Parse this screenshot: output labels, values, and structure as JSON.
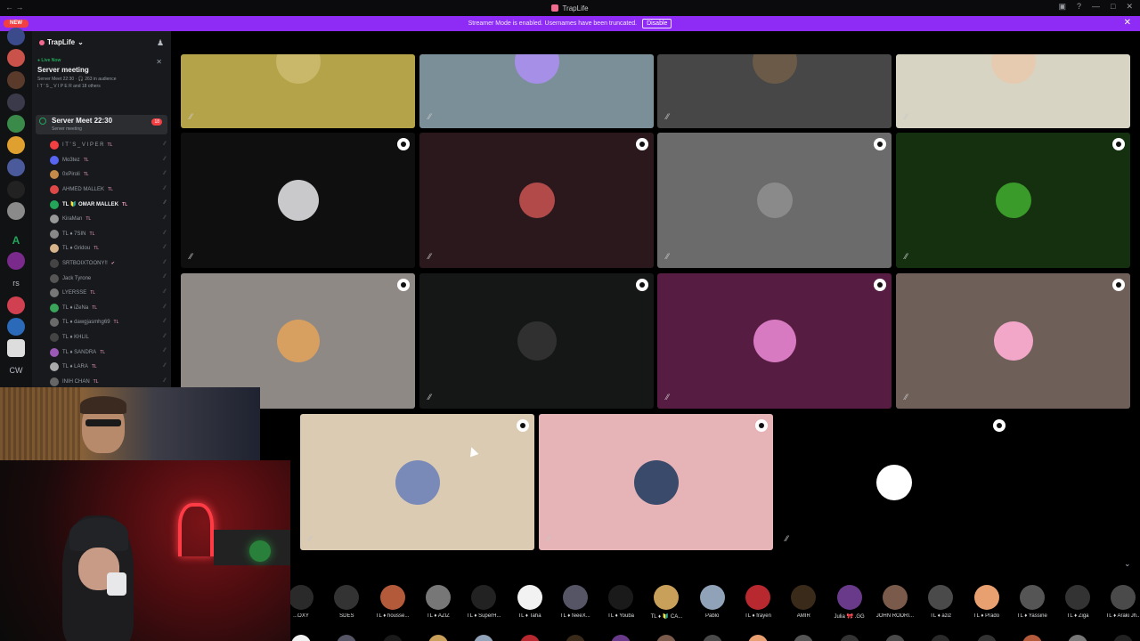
{
  "window": {
    "title": "TrapLife"
  },
  "banner": {
    "text": "Streamer Mode is enabled. Usernames have been truncated.",
    "disable_label": "Disable"
  },
  "rail": {
    "new_badge": "NEW",
    "letter_a": "A",
    "text_rs": "rs",
    "text_cw": "CW"
  },
  "server": {
    "name": "TrapLife"
  },
  "live": {
    "label": "● Live Now",
    "title": "Server meeting",
    "line1": "Server Meet 22:30 · 🎧 263 in audience",
    "line2": "I T ' S _ V I P E R and 18 others"
  },
  "stage_channel": {
    "name": "Server Meet 22:30",
    "sub": "Server meeting",
    "count": "18"
  },
  "members": [
    {
      "name": "I T ' S _ V I P E R",
      "tag": "TL",
      "color": "#f23f42"
    },
    {
      "name": "Mo3tez",
      "tag": "TL",
      "color": "#5865f2"
    },
    {
      "name": "0xPiroli",
      "tag": "TL",
      "color": "#c38a4a"
    },
    {
      "name": "AHMED MALLEK",
      "tag": "TL",
      "color": "#e04848"
    },
    {
      "name": "TL 🔰 OMAR MALLEK",
      "tag": "TL",
      "color": "#23a55a"
    },
    {
      "name": "KiraMan",
      "tag": "TL",
      "color": "#999"
    },
    {
      "name": "TL ♦ 7SIN",
      "tag": "TL",
      "color": "#888"
    },
    {
      "name": "TL ♦ Gridou",
      "tag": "TL",
      "color": "#d8b48c"
    },
    {
      "name": "SRTBOIXTOONY!!",
      "tag": "✔",
      "color": "#444"
    },
    {
      "name": "Jack Tyrone",
      "tag": "",
      "color": "#555"
    },
    {
      "name": "LYERSSE",
      "tag": "TL",
      "color": "#777"
    },
    {
      "name": "TL ♦ iZeNa",
      "tag": "TL",
      "color": "#3aa55a"
    },
    {
      "name": "TL ♦ dawgjasmhg69",
      "tag": "TL",
      "color": "#6a6a6a"
    },
    {
      "name": "TL ♦ KHLIL",
      "tag": "",
      "color": "#444"
    },
    {
      "name": "TL ♦ SANDRA",
      "tag": "TL",
      "color": "#9b59b6"
    },
    {
      "name": "TL ♦ LARA",
      "tag": "TL",
      "color": "#aaa"
    },
    {
      "name": "INIH CHAN",
      "tag": "TL",
      "color": "#666"
    }
  ],
  "audience": [
    {
      "name": "...OXY",
      "color": "#2a2a2a"
    },
    {
      "name": "SDES",
      "color": "#333"
    },
    {
      "name": "TL ♦ housse...",
      "color": "#b35a3a"
    },
    {
      "name": "TL ♦ AZIZ",
      "color": "#777"
    },
    {
      "name": "TL ♦ SuperH...",
      "color": "#222"
    },
    {
      "name": "TL ♦ Taha",
      "color": "#f2f2f2"
    },
    {
      "name": "TL ♦ feeeX...",
      "color": "#556"
    },
    {
      "name": "TL ♦ Youba",
      "color": "#1a1a1a"
    },
    {
      "name": "TL ♦ 🔰 CA...",
      "color": "#c9a05a"
    },
    {
      "name": "Pablo",
      "color": "#8fa2b8"
    },
    {
      "name": "TL ♦ frayen",
      "color": "#b8282f"
    },
    {
      "name": "AMIR",
      "color": "#3a2a1a"
    },
    {
      "name": "Julia 🎀 .GG",
      "color": "#6a3a8a"
    },
    {
      "name": "JOHN RODRI...",
      "color": "#7a5a4a"
    },
    {
      "name": "TL ♦ aziz",
      "color": "#4a4a4a"
    },
    {
      "name": "TL ♦ Prado",
      "color": "#e8a070"
    },
    {
      "name": "TL ♦ Yassine",
      "color": "#555"
    },
    {
      "name": "TL ♦ Ziga",
      "color": "#333"
    },
    {
      "name": "TL ♦ Araki Jh...",
      "color": "#4a4a4a"
    }
  ],
  "tiles": [
    {
      "bg": "#b5a34a",
      "avatar": "#c9b76a"
    },
    {
      "bg": "#7b8f99",
      "avatar": "#a68fe6"
    },
    {
      "bg": "#474747",
      "avatar": "#6b5a48"
    },
    {
      "bg": "#d8d4c3",
      "avatar": "#e6cbb0"
    },
    {
      "bg": "#0f0f0f",
      "avatar": "#c9c9cc"
    },
    {
      "bg": "#2a181d",
      "avatar": "#b24a4a"
    },
    {
      "bg": "#6b6b6b",
      "avatar": "#8a8a8a"
    },
    {
      "bg": "#14300f",
      "avatar": "#3a9a2a"
    },
    {
      "bg": "#8f8985",
      "avatar": "#d8a060"
    },
    {
      "bg": "#151717",
      "avatar": "#303030"
    },
    {
      "bg": "#561c42",
      "avatar": "#d87ac2"
    },
    {
      "bg": "#6e5f58",
      "avatar": "#f2a6c8"
    },
    {
      "bg": "#dccbb3",
      "avatar": "#7a8ab8"
    },
    {
      "bg": "#e6b3b6",
      "avatar": "#3a4a6a"
    },
    {
      "bg": "#000000",
      "avatar": "#ffffff"
    }
  ],
  "icons": {
    "mic_off": "mic-off-icon",
    "watch": "watch-stream-icon",
    "chevron": "chevron-down-icon"
  }
}
